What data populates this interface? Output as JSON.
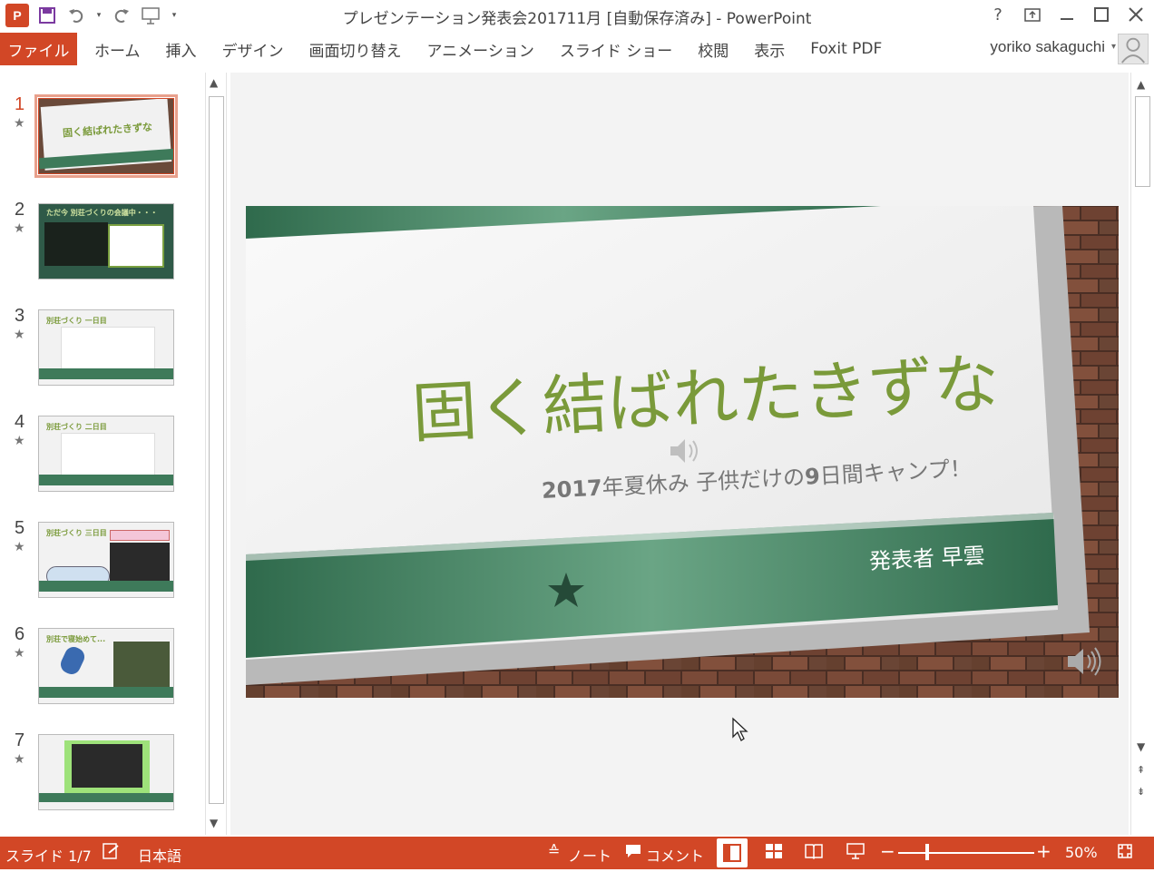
{
  "app": {
    "window_title": "プレゼンテーション発表会201711月 [自動保存済み] - PowerPoint",
    "user_name": "yoriko sakaguchi",
    "logo_letter": "P"
  },
  "ribbon": {
    "file_tab": "ファイル",
    "tabs": [
      "ホーム",
      "挿入",
      "デザイン",
      "画面切り替え",
      "アニメーション",
      "スライド ショー",
      "校閲",
      "表示",
      "Foxit PDF"
    ]
  },
  "thumbnails": [
    {
      "num": "1",
      "title": "固く結ばれたきずな"
    },
    {
      "num": "2",
      "title": "ただ今 別荘づくりの会議中・・・"
    },
    {
      "num": "3",
      "title": "別荘づくり 一日目"
    },
    {
      "num": "4",
      "title": "別荘づくり 二日目"
    },
    {
      "num": "5",
      "title": "別荘づくり 三日目"
    },
    {
      "num": "6",
      "title": "別荘で寝始めて..."
    },
    {
      "num": "7",
      "title": ""
    }
  ],
  "slide": {
    "title": "固く結ばれたきずな",
    "subtitle_year": "2017",
    "subtitle_rest": "年夏休み 子供だけの",
    "subtitle_num": "9",
    "subtitle_end": "日間キャンプ！",
    "presenter": "発表者 早雲"
  },
  "status": {
    "slide_info": "スライド 1/7",
    "language": "日本語",
    "notes": "ノート",
    "comments": "コメント",
    "zoom": "50%"
  },
  "colors": {
    "accent": "#d24726",
    "slide_green": "#3e7a5a",
    "title_green": "#7a9a3a"
  }
}
